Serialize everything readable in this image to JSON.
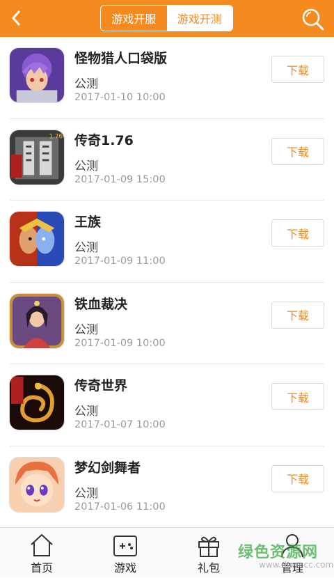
{
  "header": {
    "tabs": [
      {
        "label": "游戏开服",
        "active": false
      },
      {
        "label": "游戏开测",
        "active": true
      }
    ],
    "accent_color": "#f58a1f"
  },
  "games": [
    {
      "name": "怪物猎人口袋版",
      "status": "公测",
      "date": "2017-01-10 10:00",
      "button": "下载",
      "icon": "anime-hero-icon"
    },
    {
      "name": "传奇1.76",
      "status": "公测",
      "date": "2017-01-09 15:00",
      "button": "下载",
      "icon": "dragon-glyph-icon"
    },
    {
      "name": "王族",
      "status": "公测",
      "date": "2017-01-09 11:00",
      "button": "下载",
      "icon": "warrior-face-icon"
    },
    {
      "name": "铁血裁决",
      "status": "公测",
      "date": "2017-01-09 10:00",
      "button": "下载",
      "icon": "heroine-icon"
    },
    {
      "name": "传奇世界",
      "status": "公测",
      "date": "2017-01-07 10:00",
      "button": "下载",
      "icon": "golden-dragon-icon"
    },
    {
      "name": "梦幻剑舞者",
      "status": "公测",
      "date": "2017-01-06 11:00",
      "button": "下载",
      "icon": "chibi-girl-icon"
    }
  ],
  "tabbar": {
    "items": [
      {
        "label": "首页",
        "icon": "home-icon"
      },
      {
        "label": "游戏",
        "icon": "gamepad-icon"
      },
      {
        "label": "礼包",
        "icon": "gift-icon"
      },
      {
        "label": "管理",
        "icon": "user-icon"
      }
    ]
  },
  "watermark": {
    "text": "绿色资源网",
    "url": "www.downcc.com"
  }
}
